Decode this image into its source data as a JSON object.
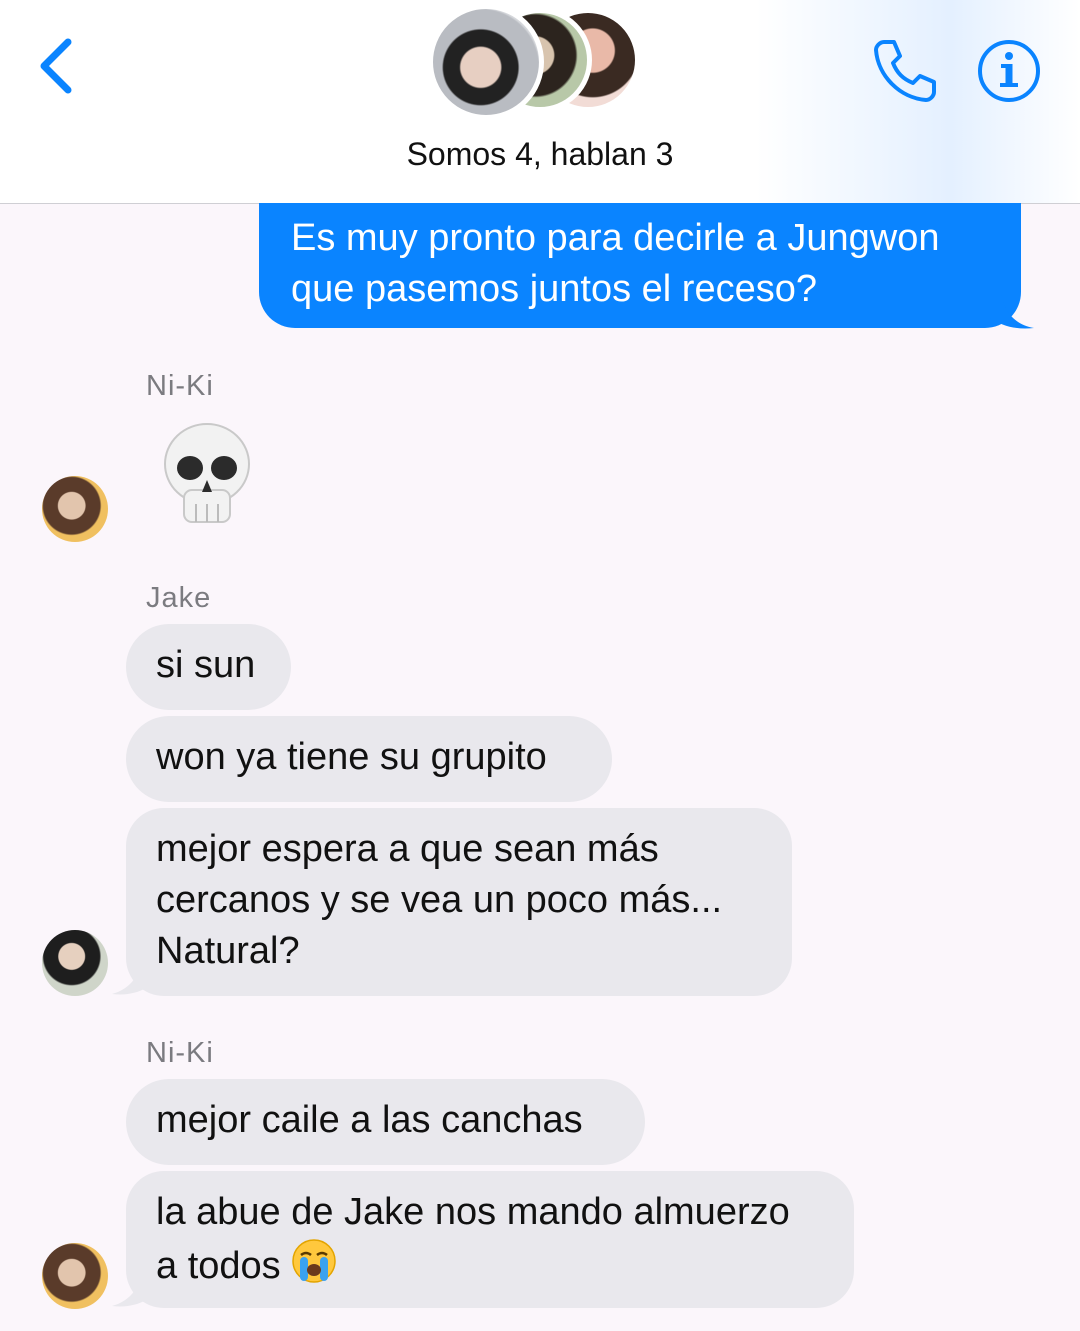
{
  "header": {
    "title": "Somos 4, hablan 3",
    "back_icon": "chevron-left-icon",
    "call_icon": "phone-icon",
    "info_icon": "info-icon",
    "accent": "#0a84ff"
  },
  "messages": [
    {
      "direction": "outgoing",
      "lines": [
        "Es muy pronto para decirle a Jungwon",
        "que pasemos juntos el receso?"
      ]
    },
    {
      "direction": "incoming",
      "sender": "Ni-Ki",
      "emoji": "skull-emoji"
    },
    {
      "direction": "incoming",
      "sender": "Jake",
      "lines": [
        "si sun"
      ]
    },
    {
      "direction": "incoming",
      "lines": [
        "won ya tiene su grupito"
      ]
    },
    {
      "direction": "incoming",
      "lines": [
        "mejor espera a que sean más",
        "cercanos y se vea un poco más...",
        "Natural?"
      ]
    },
    {
      "direction": "incoming",
      "sender": "Ni-Ki",
      "lines": [
        "mejor caile a las canchas"
      ]
    },
    {
      "direction": "incoming",
      "lines": [
        "la abue de Jake nos mando almuerzo",
        "a todos"
      ],
      "trailing_emoji": "loudly-crying-face-emoji"
    }
  ],
  "colors": {
    "outgoing_bubble": "#0a84ff",
    "incoming_bubble": "#e9e8ed",
    "background": "#fbf6fb"
  }
}
